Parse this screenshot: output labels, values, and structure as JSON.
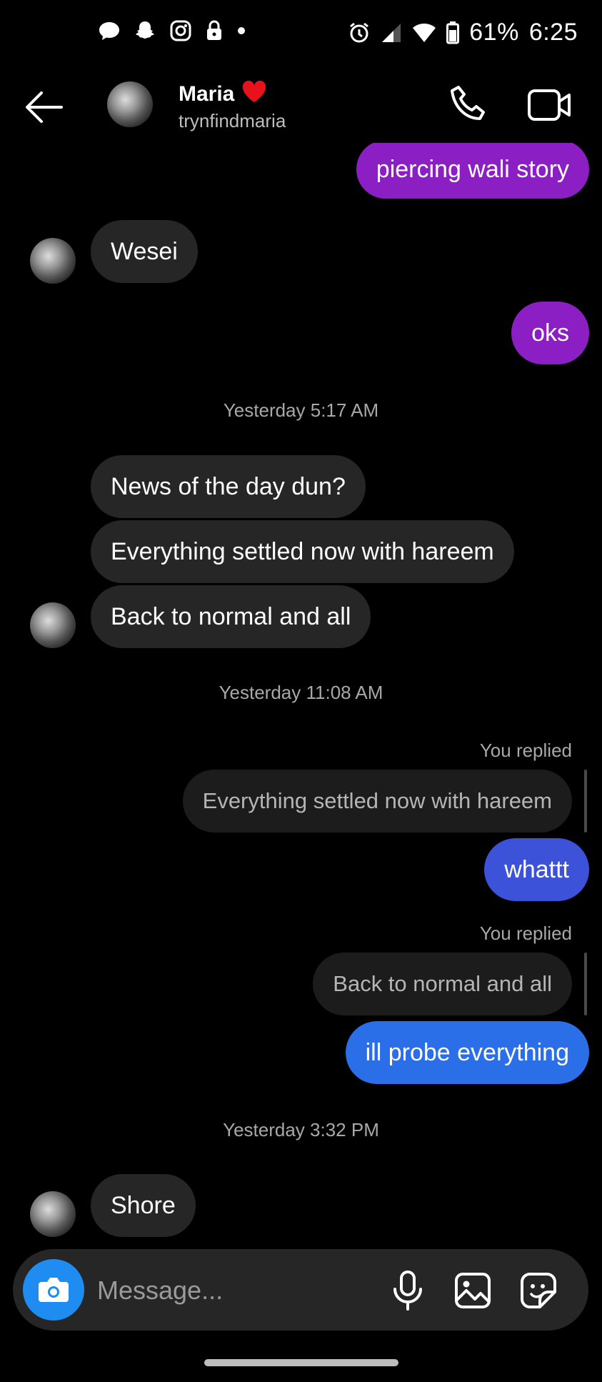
{
  "status_bar": {
    "battery": "61%",
    "time": "6:25",
    "left_icons": [
      "chat-bubble-icon",
      "snapchat-icon",
      "instagram-icon",
      "lock-icon",
      "dot-icon"
    ],
    "right_icons": [
      "alarm-icon",
      "signal-icon",
      "wifi-icon",
      "battery-icon"
    ]
  },
  "header": {
    "name": "Maria",
    "name_emoji": "❤️",
    "username": "trynfindmaria"
  },
  "messages": {
    "m1": "piercing wali story",
    "m2": "Wesei",
    "m3": "oks",
    "ts1": "Yesterday 5:17 AM",
    "m4": "News of the day dun?",
    "m5": "Everything settled now with hareem",
    "m6": "Back to normal and all",
    "ts2": "Yesterday 11:08 AM",
    "replied_label_1": "You replied",
    "quote1": "Everything settled now with hareem",
    "m7": "whattt",
    "replied_label_2": "You replied",
    "quote2": "Back to normal and all",
    "m8": "ill probe everything",
    "ts3": "Yesterday 3:32 PM",
    "m9": "Shore"
  },
  "composer": {
    "placeholder": "Message..."
  },
  "colors": {
    "outgoing_purple": "#8b1fc4",
    "outgoing_violet": "#3c52d9",
    "outgoing_blue": "#2a6ee8",
    "incoming": "#262626",
    "camera_button": "#1e8cf0"
  }
}
